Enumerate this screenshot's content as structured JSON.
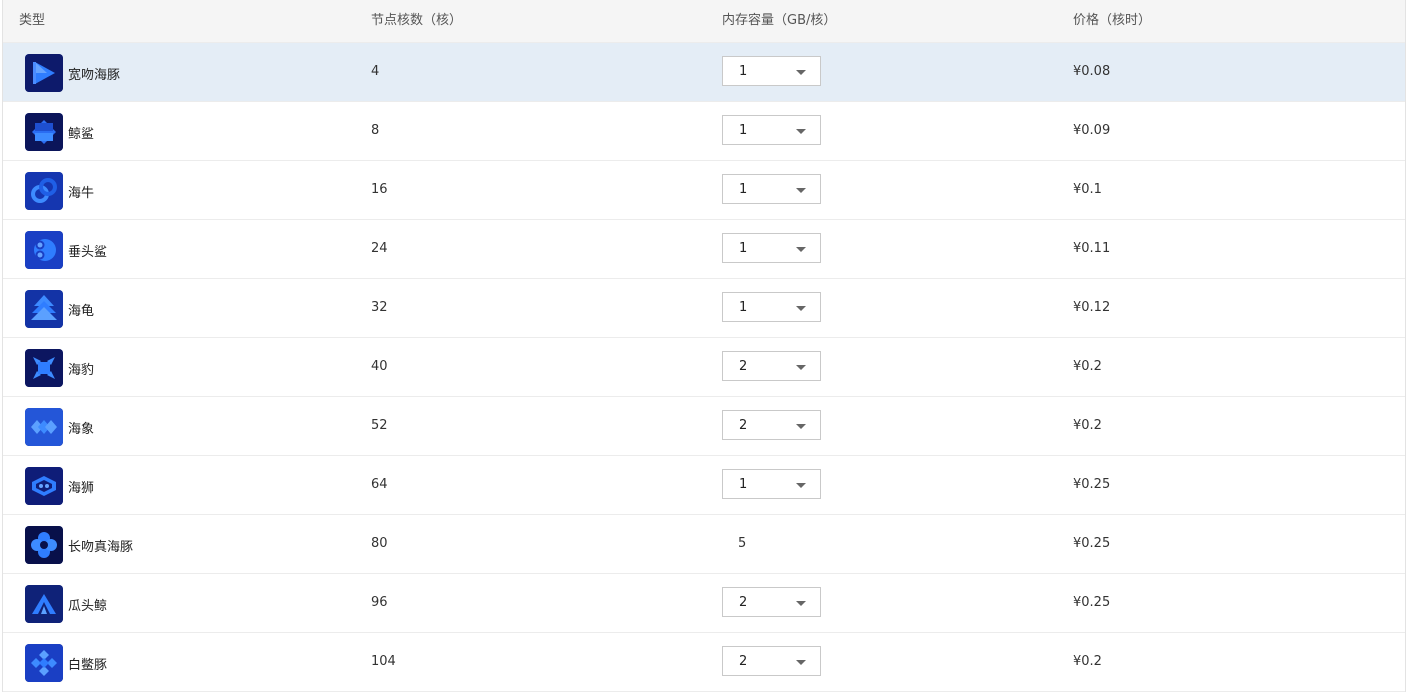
{
  "header": {
    "type": "类型",
    "cores": "节点核数（核）",
    "memory": "内存容量（GB/核）",
    "price": "价格（核时）"
  },
  "rows": [
    {
      "name": "宽吻海豚",
      "cores": "4",
      "memory": "1",
      "price": "¥0.08",
      "icon": "dolphin-play-icon"
    },
    {
      "name": "鲸鲨",
      "cores": "8",
      "memory": "1",
      "price": "¥0.09",
      "icon": "whale-shark-icon"
    },
    {
      "name": "海牛",
      "cores": "16",
      "memory": "1",
      "price": "¥0.1",
      "icon": "manatee-icon"
    },
    {
      "name": "垂头鲨",
      "cores": "24",
      "memory": "1",
      "price": "¥0.11",
      "icon": "hammerhead-icon"
    },
    {
      "name": "海龟",
      "cores": "32",
      "memory": "1",
      "price": "¥0.12",
      "icon": "turtle-icon"
    },
    {
      "name": "海豹",
      "cores": "40",
      "memory": "2",
      "price": "¥0.2",
      "icon": "seal-icon"
    },
    {
      "name": "海象",
      "cores": "52",
      "memory": "2",
      "price": "¥0.2",
      "icon": "walrus-icon"
    },
    {
      "name": "海狮",
      "cores": "64",
      "memory": "1",
      "price": "¥0.25",
      "icon": "sea-lion-icon"
    },
    {
      "name": "长吻真海豚",
      "cores": "80",
      "memory": "5",
      "price": "¥0.25",
      "icon": "long-beaked-dolphin-icon"
    },
    {
      "name": "瓜头鲸",
      "cores": "96",
      "memory": "2",
      "price": "¥0.25",
      "icon": "melon-headed-whale-icon"
    },
    {
      "name": "白鳖豚",
      "cores": "104",
      "memory": "2",
      "price": "¥0.2",
      "icon": "baiji-icon"
    }
  ],
  "colors": {
    "header_bg": "#f5f5f5",
    "selected_row_bg": "#e4edf6",
    "icon_gradient_start": "#1f3fb0",
    "icon_gradient_end": "#0c1a66",
    "icon_accent": "#2f7dff"
  }
}
